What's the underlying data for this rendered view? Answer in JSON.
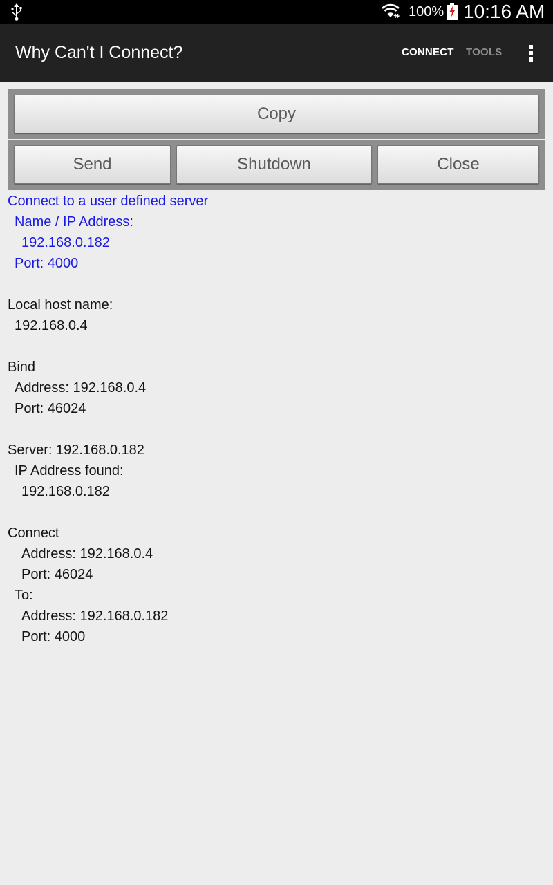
{
  "status_bar": {
    "battery_percent": "100%",
    "time": "10:16 AM",
    "icons": [
      "usb-icon",
      "wifi-icon",
      "battery-charging-icon"
    ]
  },
  "action_bar": {
    "title": "Why Can't I Connect?",
    "tabs": [
      {
        "label": "CONNECT",
        "active": true
      },
      {
        "label": "TOOLS",
        "active": false
      }
    ],
    "overflow_icon": "more-vert-icon"
  },
  "buttons": {
    "copy": "Copy",
    "send": "Send",
    "shutdown": "Shutdown",
    "close": "Close"
  },
  "colors": {
    "accent_text": "#1a1ae6",
    "action_bar": "#222222",
    "background": "#ededed"
  },
  "log": {
    "lines": [
      "Connect to a user defined server",
      "Name / IP Address:",
      "192.168.0.182",
      "Port: 4000",
      "",
      "Local host name:",
      "192.168.0.4",
      "",
      "Bind",
      "Address: 192.168.0.4",
      "Port: 46024",
      "",
      "Server: 192.168.0.182",
      "IP Address found:",
      "192.168.0.182",
      "",
      "Connect",
      "Address: 192.168.0.4",
      "Port: 46024",
      "To:",
      "Address: 192.168.0.182",
      "Port: 4000"
    ]
  }
}
